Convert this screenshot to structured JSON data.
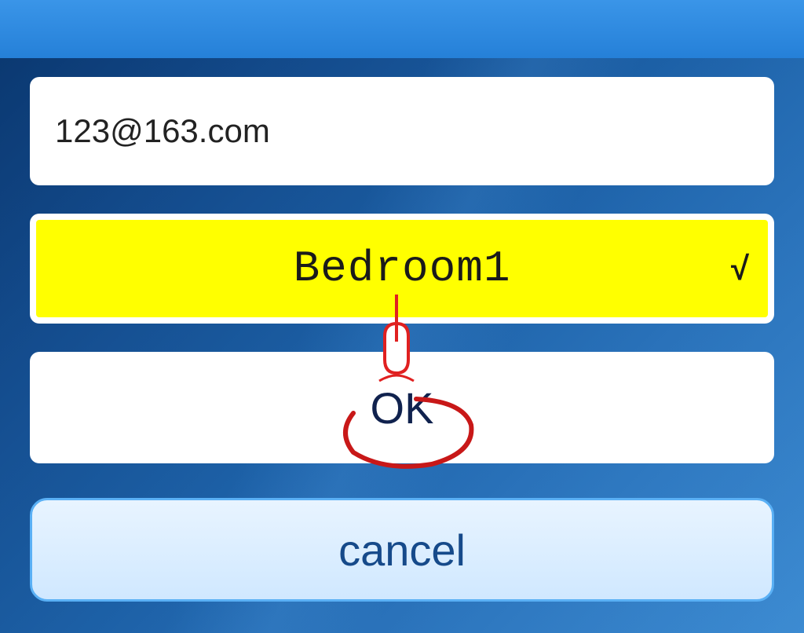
{
  "email": {
    "value": "123@163.com"
  },
  "room_selection": {
    "label": "Bedroom1",
    "check": "√"
  },
  "actions": {
    "ok": "OK",
    "cancel": "cancel"
  },
  "annotation": {
    "pointer_color": "#e02020",
    "circle_color": "#c81818"
  }
}
